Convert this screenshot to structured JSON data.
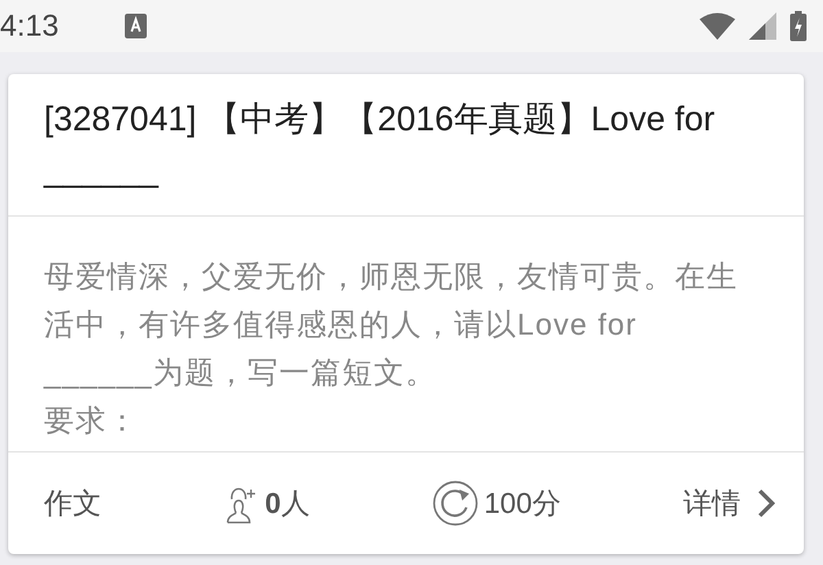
{
  "status_bar": {
    "time": "4:13"
  },
  "card": {
    "title": "[3287041] 【中考】【2016年真题】Love for ______",
    "description": "母爱情深，父爱无价，师恩无限，友情可贵。在生活中，有许多值得感恩的人，请以Love for ______为题，写一篇短文。",
    "requirement_label": "要求：",
    "footer": {
      "category": "作文",
      "participants": "**0**人",
      "score": "100分",
      "details": "详情"
    }
  }
}
